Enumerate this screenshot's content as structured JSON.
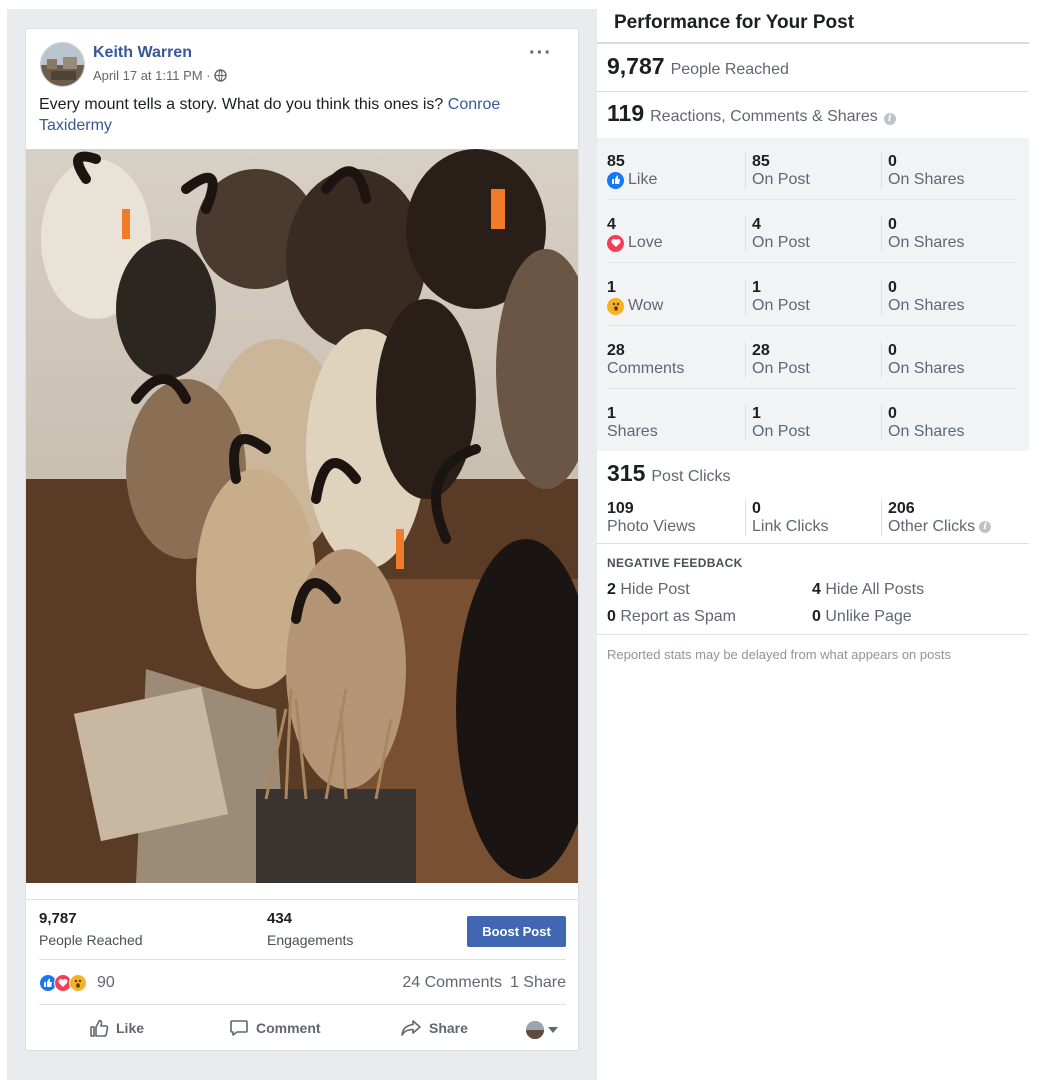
{
  "post": {
    "author": "Keith Warren",
    "timestamp": "April 17 at 1:11 PM ·",
    "more_label": "···",
    "text": "Every mount tells a story. What do you think this ones is? ",
    "tag_link": "Conroe Taxidermy",
    "stats": {
      "reached_value": "9,787",
      "reached_label": "People Reached",
      "engagements_value": "434",
      "engagements_label": "Engagements",
      "boost_label": "Boost Post"
    },
    "reactions": {
      "icons": [
        "like-icon",
        "love-icon",
        "wow-icon"
      ],
      "count": "90",
      "comments": "24 Comments",
      "shares": "1 Share"
    },
    "actions": {
      "like": "Like",
      "comment": "Comment",
      "share": "Share"
    }
  },
  "performance": {
    "title": "Performance for Your Post",
    "people_reached_value": "9,787",
    "people_reached_label": "People Reached",
    "engagement_value": "119",
    "engagement_label": "Reactions, Comments & Shares",
    "rows": [
      {
        "value": "85",
        "label": "Like",
        "icon": "like-icon",
        "on_post_value": "85",
        "on_post_label": "On Post",
        "on_shares_value": "0",
        "on_shares_label": "On Shares"
      },
      {
        "value": "4",
        "label": "Love",
        "icon": "love-icon",
        "on_post_value": "4",
        "on_post_label": "On Post",
        "on_shares_value": "0",
        "on_shares_label": "On Shares"
      },
      {
        "value": "1",
        "label": "Wow",
        "icon": "wow-icon",
        "on_post_value": "1",
        "on_post_label": "On Post",
        "on_shares_value": "0",
        "on_shares_label": "On Shares"
      },
      {
        "value": "28",
        "label": "Comments",
        "icon": "",
        "on_post_value": "28",
        "on_post_label": "On Post",
        "on_shares_value": "0",
        "on_shares_label": "On Shares"
      },
      {
        "value": "1",
        "label": "Shares",
        "icon": "",
        "on_post_value": "1",
        "on_post_label": "On Post",
        "on_shares_value": "0",
        "on_shares_label": "On Shares"
      }
    ],
    "post_clicks_value": "315",
    "post_clicks_label": "Post Clicks",
    "clicks": [
      {
        "value": "109",
        "label": "Photo Views"
      },
      {
        "value": "0",
        "label": "Link Clicks"
      },
      {
        "value": "206",
        "label": "Other Clicks"
      }
    ],
    "negative_title": "NEGATIVE FEEDBACK",
    "negative": {
      "hide_post_value": "2",
      "hide_post_label": "Hide Post",
      "hide_all_value": "4",
      "hide_all_label": "Hide All Posts",
      "spam_value": "0",
      "spam_label": "Report as Spam",
      "unlike_value": "0",
      "unlike_label": "Unlike Page"
    },
    "footnote": "Reported stats may be delayed from what appears on posts"
  },
  "colors": {
    "link": "#385898",
    "boost": "#4267b2",
    "like": "#1877f2",
    "love": "#f33e58",
    "wow": "#f7b125"
  }
}
